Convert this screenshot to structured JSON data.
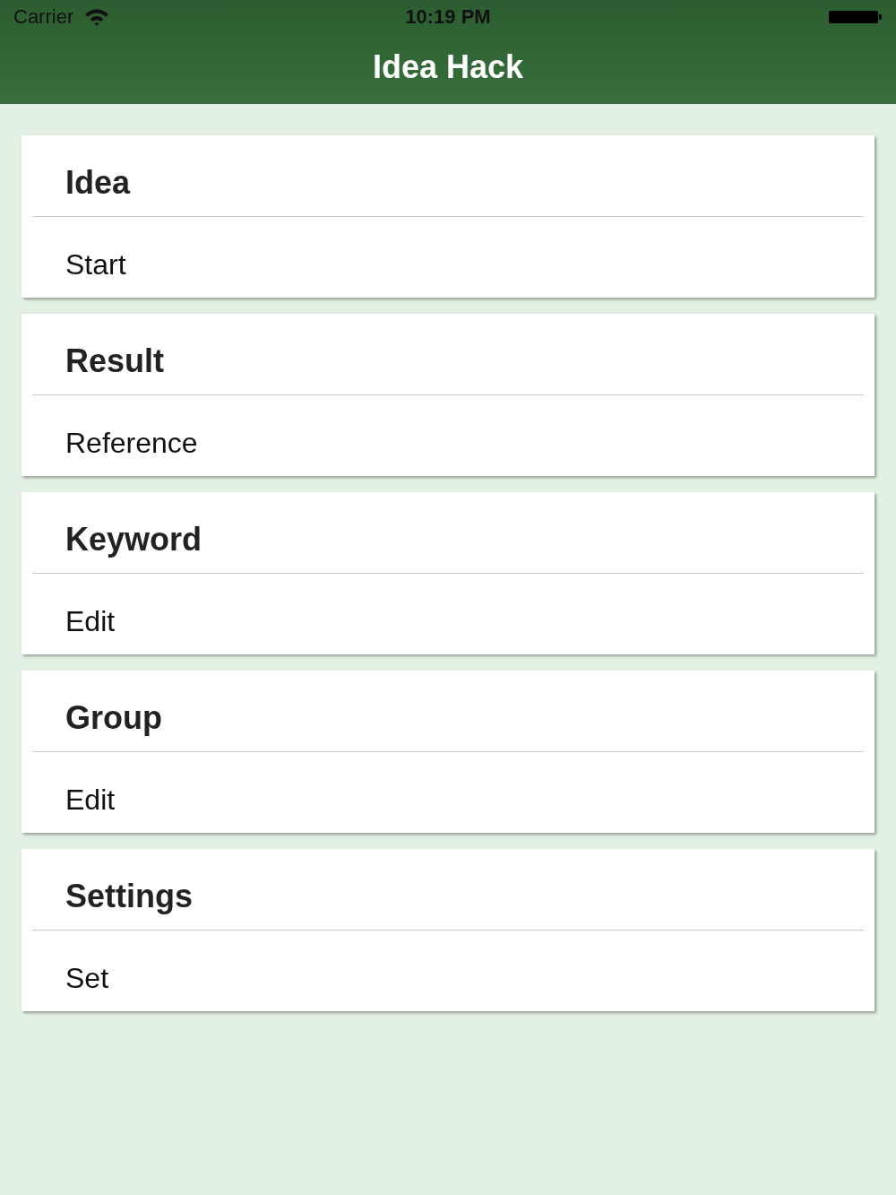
{
  "status_bar": {
    "carrier": "Carrier",
    "time": "10:19 PM"
  },
  "nav_bar": {
    "title": "Idea Hack"
  },
  "sections": [
    {
      "title": "Idea",
      "action": "Start"
    },
    {
      "title": "Result",
      "action": "Reference"
    },
    {
      "title": "Keyword",
      "action": "Edit"
    },
    {
      "title": "Group",
      "action": "Edit"
    },
    {
      "title": "Settings",
      "action": "Set"
    }
  ]
}
